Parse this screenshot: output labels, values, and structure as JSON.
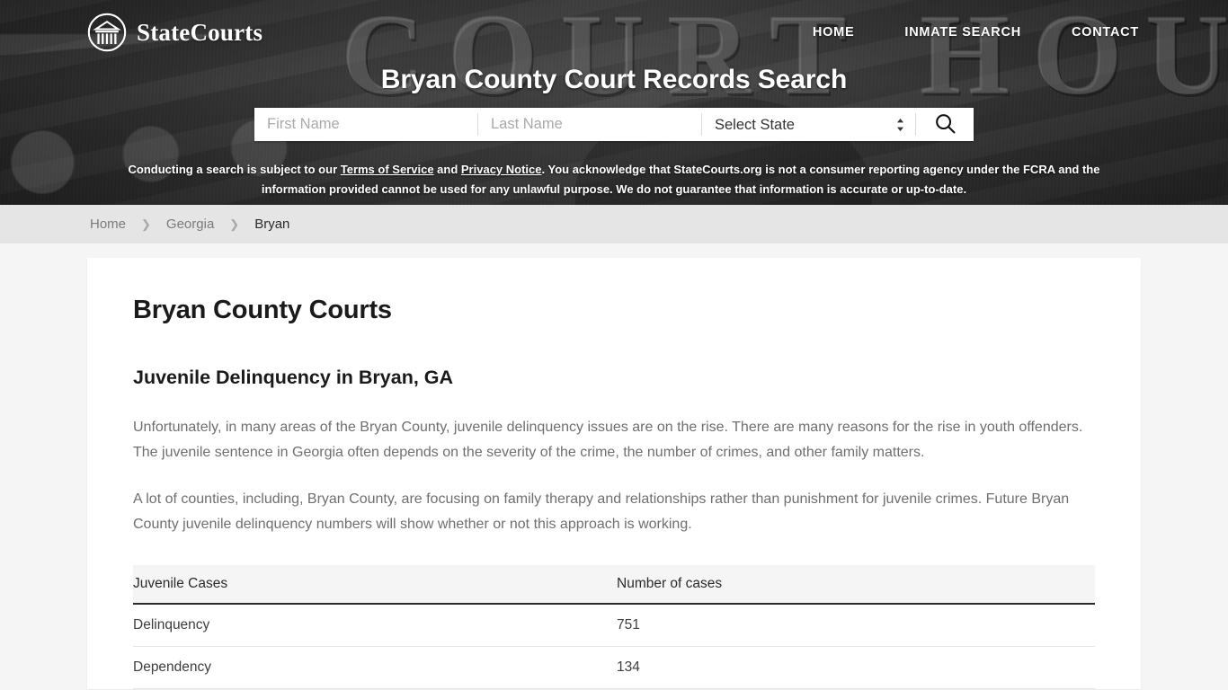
{
  "header": {
    "brand_name": "StateCourts",
    "logo_icon": "courthouse-circle-icon",
    "nav": [
      {
        "label": "HOME"
      },
      {
        "label": "INMATE SEARCH"
      },
      {
        "label": "CONTACT"
      }
    ],
    "hero_title": "Bryan County Court Records Search"
  },
  "search": {
    "first_name_value": "",
    "first_name_placeholder": "First Name",
    "last_name_value": "",
    "last_name_placeholder": "Last Name",
    "state_selected": "Select State",
    "state_options": [
      "Select State"
    ],
    "spinner_icon": "up-down-chevron-icon",
    "search_icon": "magnifier-icon"
  },
  "disclaimer": {
    "part1": "Conducting a search is subject to our ",
    "link1": "Terms of Service",
    "part2": " and ",
    "link2": "Privacy Notice",
    "part3": ". You acknowledge that StateCourts.org is not a consumer reporting agency under the FCRA and the information provided cannot be used for any unlawful purpose. We do not guarantee that information is accurate or up-to-date."
  },
  "breadcrumb": {
    "items": [
      {
        "label": "Home"
      },
      {
        "label": "Georgia"
      },
      {
        "label": "Bryan"
      }
    ],
    "separator": "❯"
  },
  "main": {
    "page_title": "Bryan County Courts",
    "section_title": "Juvenile Delinquency in Bryan, GA",
    "paragraph1": "Unfortunately, in many areas of the Bryan County, juvenile delinquency issues are on the rise. There are many reasons for the rise in youth offenders. The juvenile sentence in Georgia often depends on the severity of the crime, the number of crimes, and other family matters.",
    "paragraph2": "A lot of counties, including, Bryan County, are focusing on family therapy and relationships rather than punishment for juvenile crimes. Future Bryan County juvenile delinquency numbers will show whether or not this approach is working.",
    "table": {
      "headers": [
        "Juvenile Cases",
        "Number of cases"
      ],
      "rows": [
        {
          "case_type": "Delinquency",
          "count": "751"
        },
        {
          "case_type": "Dependency",
          "count": "134"
        }
      ]
    }
  },
  "colors": {
    "hero_overlay": "#3a3a3a",
    "breadcrumb_bg": "#e5e5e5",
    "page_bg": "#f5f5f5",
    "card_bg": "#ffffff",
    "body_text": "#6f6f6f",
    "heading_text": "#1a1a1a"
  }
}
